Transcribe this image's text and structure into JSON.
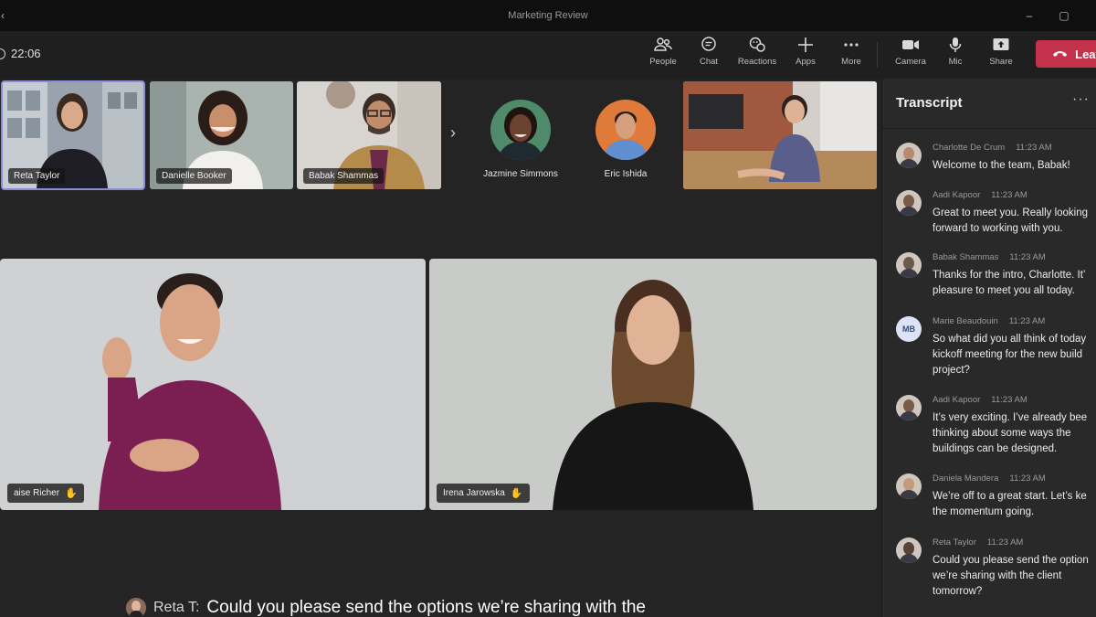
{
  "window": {
    "title": "Marketing Review"
  },
  "toolbar": {
    "timer": "22:06",
    "buttons": [
      {
        "label": "People",
        "icon": "people-icon"
      },
      {
        "label": "Chat",
        "icon": "chat-icon"
      },
      {
        "label": "Reactions",
        "icon": "reactions-icon"
      },
      {
        "label": "Apps",
        "icon": "plus-icon"
      },
      {
        "label": "More",
        "icon": "more-icon"
      },
      {
        "label": "Camera",
        "icon": "camera-icon"
      },
      {
        "label": "Mic",
        "icon": "mic-icon"
      },
      {
        "label": "Share",
        "icon": "share-icon"
      }
    ],
    "leave_label": "Leave"
  },
  "gallery": {
    "tiles": [
      {
        "name": "Reta Taylor"
      },
      {
        "name": "Danielle Booker"
      },
      {
        "name": "Babak Shammas"
      },
      {
        "name": "Jazmine Simmons"
      },
      {
        "name": "Eric Ishida"
      }
    ]
  },
  "main": {
    "videos": [
      {
        "name": "aise Richer"
      },
      {
        "name": "Irena Jarowska"
      }
    ]
  },
  "caption": {
    "speaker": "Reta T:",
    "text": "Could you please send the options we’re sharing with the"
  },
  "transcript": {
    "title": "Transcript",
    "messages": [
      {
        "name": "Charlotte De Crum",
        "time": "11:23 AM",
        "text": "Welcome to the team, Babak!",
        "color": "#b98a6e"
      },
      {
        "name": "Aadi Kapoor",
        "time": "11:23 AM",
        "text": "Great to meet you. Really looking\nforward to working with you.",
        "color": "#7a5a48"
      },
      {
        "name": "Babak Shammas",
        "time": "11:23 AM",
        "text": "Thanks for the intro, Charlotte. It’\npleasure to meet you all today.",
        "color": "#6b5b4f"
      },
      {
        "name": "Marie Beaudouin",
        "time": "11:23 AM",
        "text": "So what did you all think of today\nkickoff meeting for the new build\nproject?",
        "initials": "MB"
      },
      {
        "name": "Aadi Kapoor",
        "time": "11:23 AM",
        "text": "It’s very exciting. I’ve already bee\nthinking about some ways the\nbuildings can be designed.",
        "color": "#7a5a48"
      },
      {
        "name": "Daniela Mandera",
        "time": "11:23 AM",
        "text": "We’re off to a great start. Let’s ke\nthe momentum going.",
        "color": "#c49a7a"
      },
      {
        "name": "Reta Taylor",
        "time": "11:23 AM",
        "text": "Could you please send the option\nwe’re sharing with the client\ntomorrow?",
        "color": "#5a4236"
      }
    ]
  }
}
